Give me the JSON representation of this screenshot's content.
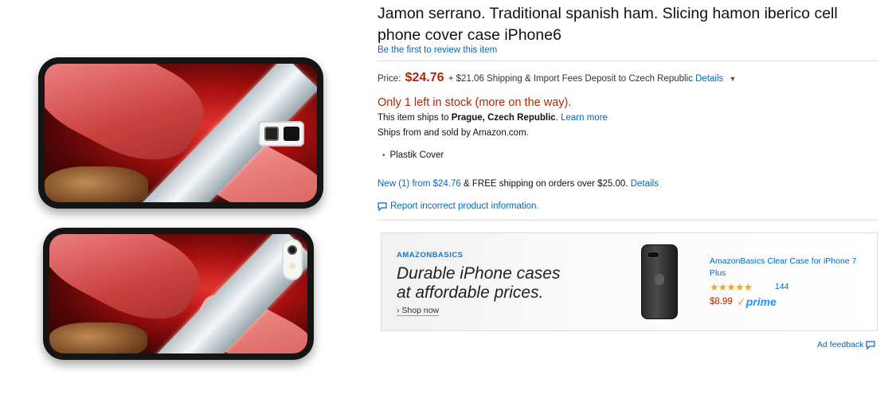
{
  "product": {
    "title": "Jamon serrano. Traditional spanish ham. Slicing hamon iberico cell phone cover case iPhone6",
    "review_link": "Be the first to review this item",
    "price_label": "Price:",
    "price": "$24.76",
    "shipping": "+ $21.06 Shipping & Import Fees Deposit to Czech Republic",
    "details_link": "Details",
    "stock": "Only 1 left in stock (more on the way).",
    "ships_prefix": "This item ships to",
    "ships_location": "Prague, Czech Republic",
    "ships_suffix": ".",
    "learn_more": "Learn more",
    "sold_by": "Ships from and sold by Amazon.com.",
    "bullets": [
      "Plastik Cover"
    ],
    "offers_link": "New (1) from $24.76",
    "offers_text": "& FREE shipping on orders over $25.00.",
    "offers_details": "Details",
    "report_link": "Report incorrect product information."
  },
  "ad": {
    "brand": "AMAZONBASICS",
    "headline_line1": "Durable iPhone cases",
    "headline_line2": "at affordable prices.",
    "shop_now": "› Shop now",
    "product_name": "AmazonBasics Clear Case for iPhone 7 Plus",
    "stars": "★★★★★",
    "rating_fraction": 0.9,
    "review_count": "144",
    "price": "$8.99",
    "prime": "prime",
    "feedback": "Ad feedback"
  },
  "colors": {
    "link": "#0066c0",
    "price": "#b12704",
    "stars": "#f0a52b",
    "prime": "#1a98ff"
  },
  "icons": {
    "report": "speech-bubble-icon",
    "feedback": "speech-bubble-icon",
    "caret": "caret-down-icon"
  }
}
